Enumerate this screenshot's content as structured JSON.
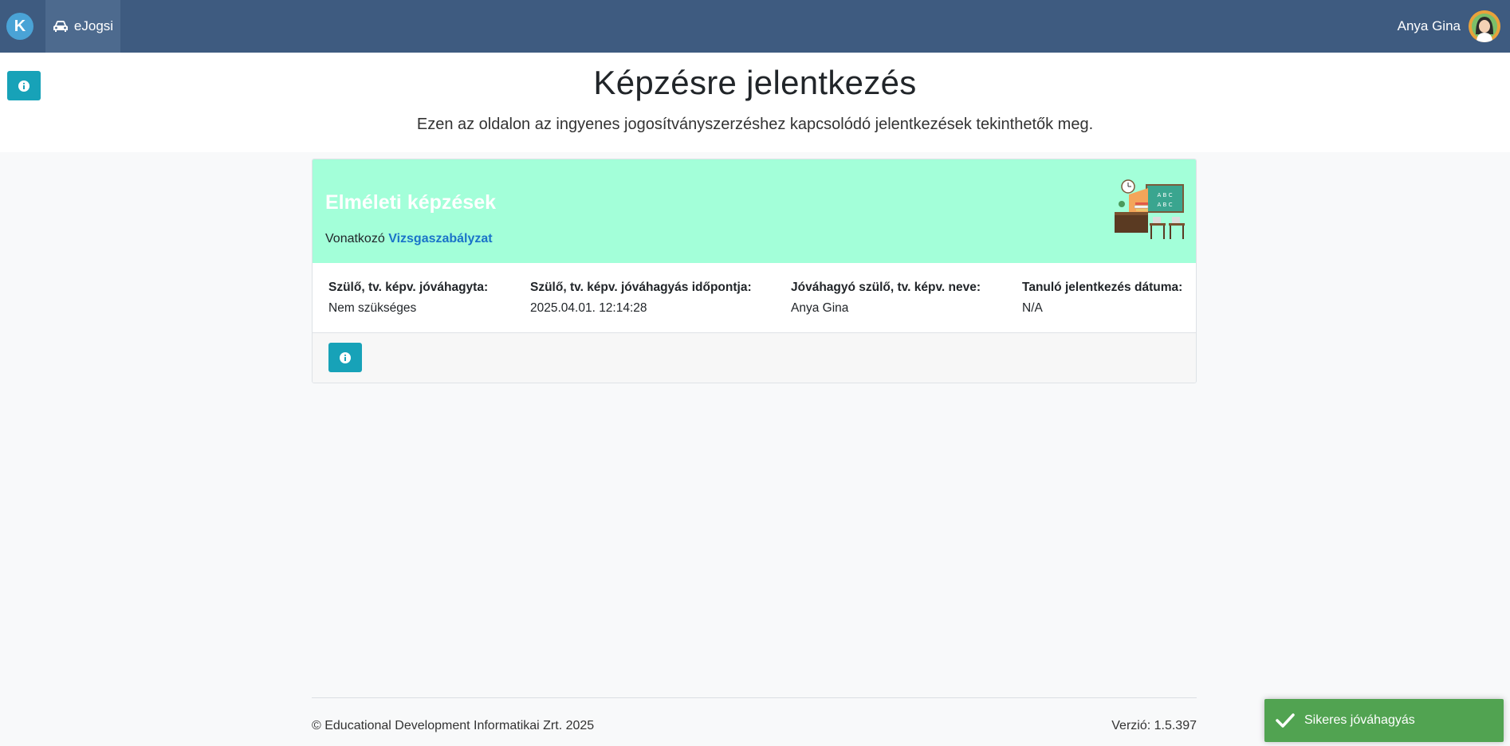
{
  "navbar": {
    "brand_letter": "K",
    "tab_label": "eJogsi",
    "user_name": "Anya Gina"
  },
  "header": {
    "title": "Képzésre jelentkezés",
    "subtitle": "Ezen az oldalon az ingyenes jogosítványszerzéshez kapcsolódó jelentkezések tekinthetők meg."
  },
  "card": {
    "title": "Elméleti képzések",
    "rule_prefix": "Vonatkozó",
    "rule_link": "Vizsgaszabályzat",
    "illustration_text_1": "A B C",
    "illustration_text_2": "A B C",
    "fields": [
      {
        "label": "Szülő, tv. képv. jóváhagyta:",
        "value": "Nem szükséges"
      },
      {
        "label": "Szülő, tv. képv. jóváhagyás időpontja:",
        "value": "2025.04.01. 12:14:28"
      },
      {
        "label": "Jóváhagyó szülő, tv. képv. neve:",
        "value": "Anya Gina"
      },
      {
        "label": "Tanuló jelentkezés dátuma:",
        "value": "N/A"
      }
    ]
  },
  "footer": {
    "copyright": "© Educational Development Informatikai Zrt. 2025",
    "version": "Verzió: 1.5.397"
  },
  "toast": {
    "message": "Sikeres jóváhagyás"
  },
  "colors": {
    "navbar": "#3e5b80",
    "card_header": "#a3ffd9",
    "info_button": "#17a2b8",
    "toast": "#51a351",
    "link": "#1a73c9"
  }
}
